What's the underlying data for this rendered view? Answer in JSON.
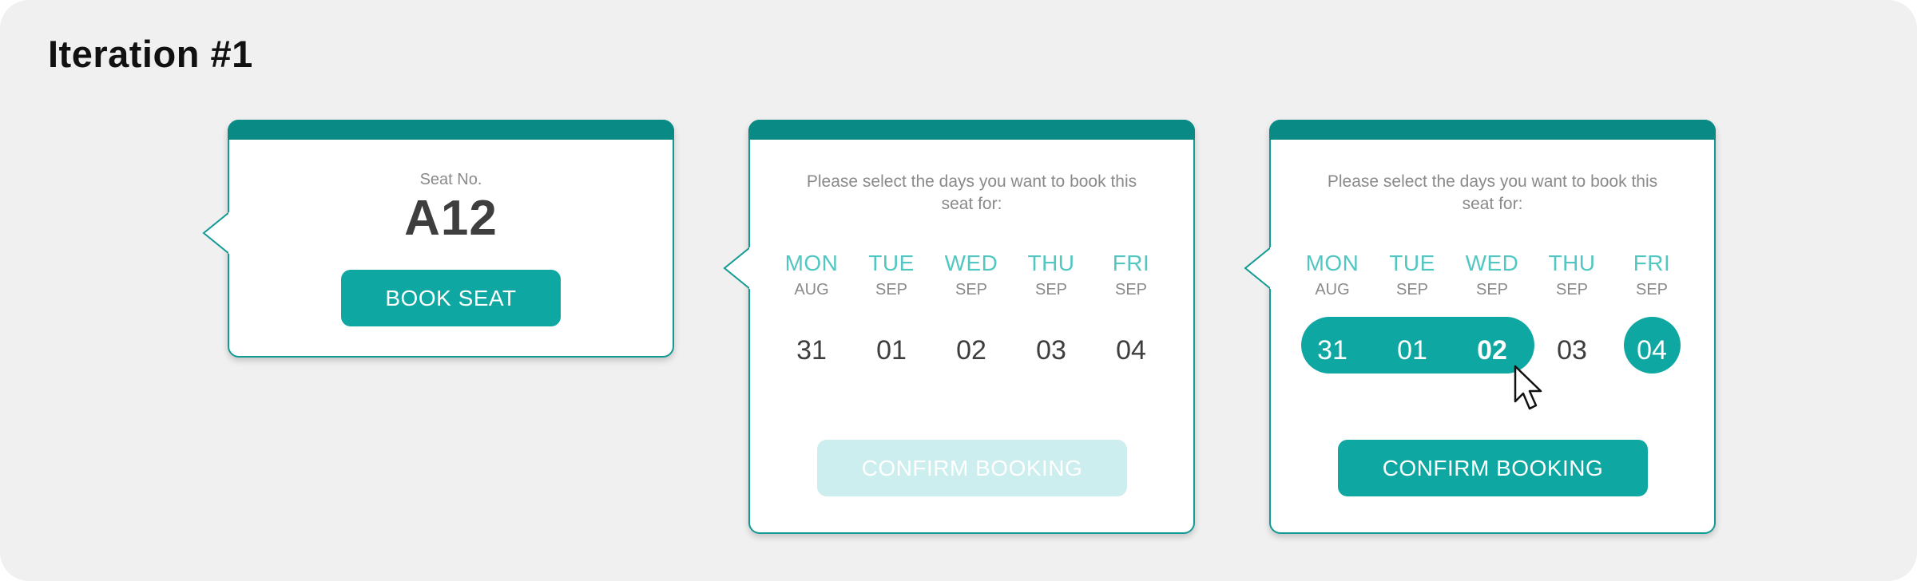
{
  "page": {
    "title": "Iteration #1"
  },
  "colors": {
    "accent": "#0ea7a1",
    "header": "#098a84",
    "day_name": "#52c7c2",
    "disabled_button": "#cdeeee",
    "text_dark": "#3e3e3e",
    "text_muted": "#8a8a8a"
  },
  "card1": {
    "seat_label": "Seat No.",
    "seat_value": "A12",
    "book_button": "BOOK SEAT"
  },
  "card2": {
    "prompt": "Please select the days you want to book this seat for:",
    "days": [
      {
        "name": "MON",
        "month": "AUG",
        "date": "31"
      },
      {
        "name": "TUE",
        "month": "SEP",
        "date": "01"
      },
      {
        "name": "WED",
        "month": "SEP",
        "date": "02"
      },
      {
        "name": "THU",
        "month": "SEP",
        "date": "03"
      },
      {
        "name": "FRI",
        "month": "SEP",
        "date": "04"
      }
    ],
    "confirm_button": "CONFIRM BOOKING",
    "confirm_enabled": false
  },
  "card3": {
    "prompt": "Please select the days you want to book this seat for:",
    "days": [
      {
        "name": "MON",
        "month": "AUG",
        "date": "31",
        "selected": true
      },
      {
        "name": "TUE",
        "month": "SEP",
        "date": "01",
        "selected": true
      },
      {
        "name": "WED",
        "month": "SEP",
        "date": "02",
        "selected": true
      },
      {
        "name": "THU",
        "month": "SEP",
        "date": "03",
        "selected": false
      },
      {
        "name": "FRI",
        "month": "SEP",
        "date": "04",
        "selected": true
      }
    ],
    "confirm_button": "CONFIRM BOOKING",
    "confirm_enabled": true
  },
  "icons": {
    "pointer": "mouse-pointer-icon"
  }
}
